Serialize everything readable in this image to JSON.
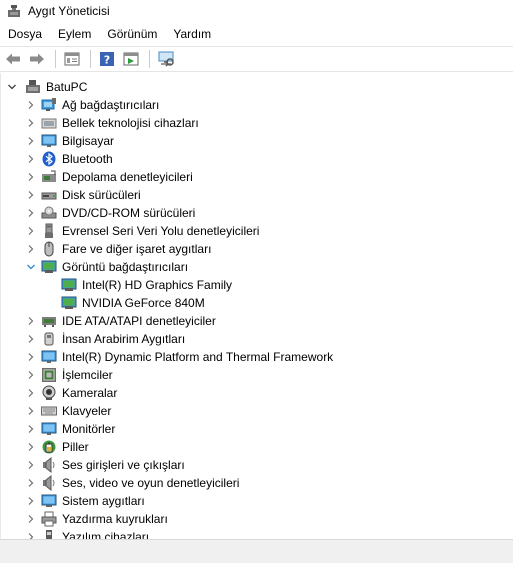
{
  "window": {
    "title": "Aygıt Yöneticisi"
  },
  "menu": [
    "Dosya",
    "Eylem",
    "Görünüm",
    "Yardım"
  ],
  "toolbar": {
    "icons": [
      "back-arrow-icon",
      "forward-arrow-icon",
      "properties-icon",
      "help-icon",
      "update-driver-icon",
      "scan-hardware-icon"
    ]
  },
  "tree": {
    "root": {
      "label": "BatuPC",
      "icon": "computer-icon",
      "expanded": true
    },
    "items": [
      {
        "label": "Ağ bağdaştırıcıları",
        "icon": "network-adapter-icon",
        "expanded": false
      },
      {
        "label": "Bellek teknolojisi cihazları",
        "icon": "memory-device-icon",
        "expanded": false
      },
      {
        "label": "Bilgisayar",
        "icon": "monitor-icon",
        "expanded": false
      },
      {
        "label": "Bluetooth",
        "icon": "bluetooth-icon",
        "expanded": false
      },
      {
        "label": "Depolama denetleyicileri",
        "icon": "storage-controller-icon",
        "expanded": false
      },
      {
        "label": "Disk sürücüleri",
        "icon": "disk-drive-icon",
        "expanded": false
      },
      {
        "label": "DVD/CD-ROM sürücüleri",
        "icon": "dvd-drive-icon",
        "expanded": false
      },
      {
        "label": "Evrensel Seri Veri Yolu denetleyicileri",
        "icon": "usb-icon",
        "expanded": false
      },
      {
        "label": "Fare ve diğer işaret aygıtları",
        "icon": "mouse-icon",
        "expanded": false
      },
      {
        "label": "Görüntü bağdaştırıcıları",
        "icon": "display-adapter-icon",
        "expanded": true,
        "children": [
          {
            "label": "Intel(R) HD Graphics Family",
            "icon": "display-adapter-icon"
          },
          {
            "label": "NVIDIA GeForce 840M",
            "icon": "display-adapter-icon"
          }
        ]
      },
      {
        "label": "IDE ATA/ATAPI denetleyiciler",
        "icon": "ide-controller-icon",
        "expanded": false
      },
      {
        "label": "İnsan Arabirim Aygıtları",
        "icon": "hid-icon",
        "expanded": false
      },
      {
        "label": "Intel(R) Dynamic Platform and Thermal Framework",
        "icon": "monitor-icon",
        "expanded": false
      },
      {
        "label": "İşlemciler",
        "icon": "processor-icon",
        "expanded": false
      },
      {
        "label": "Kameralar",
        "icon": "camera-icon",
        "expanded": false
      },
      {
        "label": "Klavyeler",
        "icon": "keyboard-icon",
        "expanded": false
      },
      {
        "label": "Monitörler",
        "icon": "monitor-icon",
        "expanded": false
      },
      {
        "label": "Piller",
        "icon": "battery-icon",
        "expanded": false
      },
      {
        "label": "Ses girişleri ve çıkışları",
        "icon": "speaker-icon",
        "expanded": false
      },
      {
        "label": "Ses, video ve oyun denetleyicileri",
        "icon": "speaker-icon",
        "expanded": false
      },
      {
        "label": "Sistem aygıtları",
        "icon": "system-devices-icon",
        "expanded": false
      },
      {
        "label": "Yazdırma kuyrukları",
        "icon": "printer-icon",
        "expanded": false
      },
      {
        "label": "Yazılım cihazları",
        "icon": "software-device-icon",
        "expanded": false
      }
    ]
  },
  "colors": {
    "accent": "#0078d7",
    "chevron": "#6d6d6d",
    "status_bar": "#f0f0f0"
  }
}
